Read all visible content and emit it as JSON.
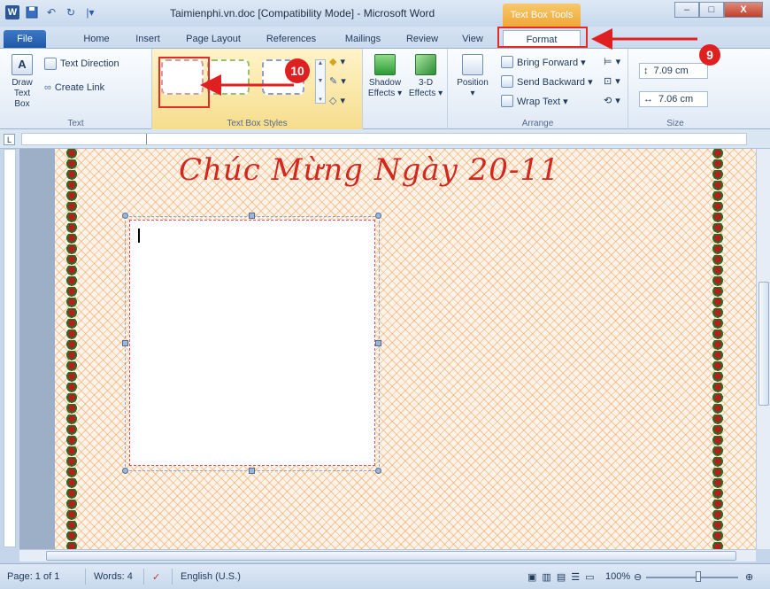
{
  "window": {
    "title": "Taimienphi.vn.doc [Compatibility Mode] - Microsoft Word",
    "context_tab_header": "Text Box Tools",
    "controls": [
      "–",
      "□",
      "X"
    ]
  },
  "qat": {
    "undo": "↶",
    "redo": "↻",
    "customize": "|▾"
  },
  "tabs": [
    "File",
    "Home",
    "Insert",
    "Page Layout",
    "References",
    "Mailings",
    "Review",
    "View",
    "Format"
  ],
  "ribbon": {
    "text_group": {
      "label": "Text",
      "draw_text_box": "Draw\nText Box",
      "text_direction": "Text Direction",
      "create_link": "Create Link"
    },
    "styles_group": {
      "label": "Text Box Styles"
    },
    "shadow_group": {
      "shadow_effects": "Shadow\nEffects ▾",
      "3d_effects": "3-D\nEffects ▾"
    },
    "arrange_group": {
      "label": "Arrange",
      "position": "Position",
      "bring_forward": "Bring Forward ▾",
      "send_backward": "Send Backward ▾",
      "wrap_text": "Wrap Text ▾"
    },
    "size_group": {
      "label": "Size",
      "height": "7.09 cm",
      "width": "7.06 cm"
    }
  },
  "document": {
    "greeting": "Chúc Mừng Ngày 20-11"
  },
  "callouts": {
    "step9": "9",
    "step10": "10"
  },
  "status": {
    "page": "Page: 1 of 1",
    "words": "Words: 4",
    "language": "English (U.S.)",
    "zoom": "100%"
  },
  "colors": {
    "callout": "#e02020",
    "file_tab": "#2b5797",
    "context_tab": "#f0a838"
  }
}
